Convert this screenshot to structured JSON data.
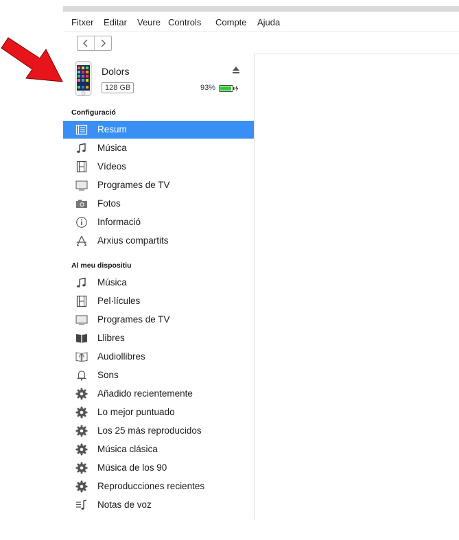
{
  "menu": [
    "Fitxer",
    "Editar",
    "Veure",
    "Controls",
    "Compte",
    "Ajuda"
  ],
  "nav": {
    "back_icon": "chevron-left-icon",
    "forward_icon": "chevron-right-icon"
  },
  "device": {
    "name": "Dolors",
    "capacity": "128 GB",
    "battery_percent": "93%",
    "battery_level": 0.93,
    "charging": true
  },
  "configuracio": {
    "title": "Configuració",
    "items": [
      {
        "label": "Resum",
        "icon": "summary-list-icon",
        "selected": true
      },
      {
        "label": "Música",
        "icon": "music-note-icon"
      },
      {
        "label": "Vídeos",
        "icon": "film-icon"
      },
      {
        "label": "Programes de TV",
        "icon": "tv-icon"
      },
      {
        "label": "Fotos",
        "icon": "camera-icon"
      },
      {
        "label": "Informació",
        "icon": "info-icon"
      },
      {
        "label": "Arxius compartits",
        "icon": "apps-icon"
      }
    ]
  },
  "dispositiu": {
    "title": "Al meu dispositiu",
    "items": [
      {
        "label": "Música",
        "icon": "music-note-icon"
      },
      {
        "label": "Pel·lícules",
        "icon": "film-icon"
      },
      {
        "label": "Programes de TV",
        "icon": "tv-icon"
      },
      {
        "label": "Llibres",
        "icon": "book-icon"
      },
      {
        "label": "Audiollibres",
        "icon": "audiobook-icon"
      },
      {
        "label": "Sons",
        "icon": "bell-icon"
      },
      {
        "label": "Añadido recientemente",
        "icon": "smart-playlist-gear-icon"
      },
      {
        "label": "Lo mejor puntuado",
        "icon": "smart-playlist-gear-icon"
      },
      {
        "label": "Los 25 más reproducidos",
        "icon": "smart-playlist-gear-icon"
      },
      {
        "label": "Música clásica",
        "icon": "smart-playlist-gear-icon"
      },
      {
        "label": "Música de los 90",
        "icon": "smart-playlist-gear-icon"
      },
      {
        "label": "Reproducciones recientes",
        "icon": "smart-playlist-gear-icon"
      },
      {
        "label": "Notas de voz",
        "icon": "voice-memo-icon"
      }
    ]
  },
  "colors": {
    "selection": "#3a8ff5",
    "battery": "#2ecc2e",
    "arrow": "#e8141b"
  }
}
